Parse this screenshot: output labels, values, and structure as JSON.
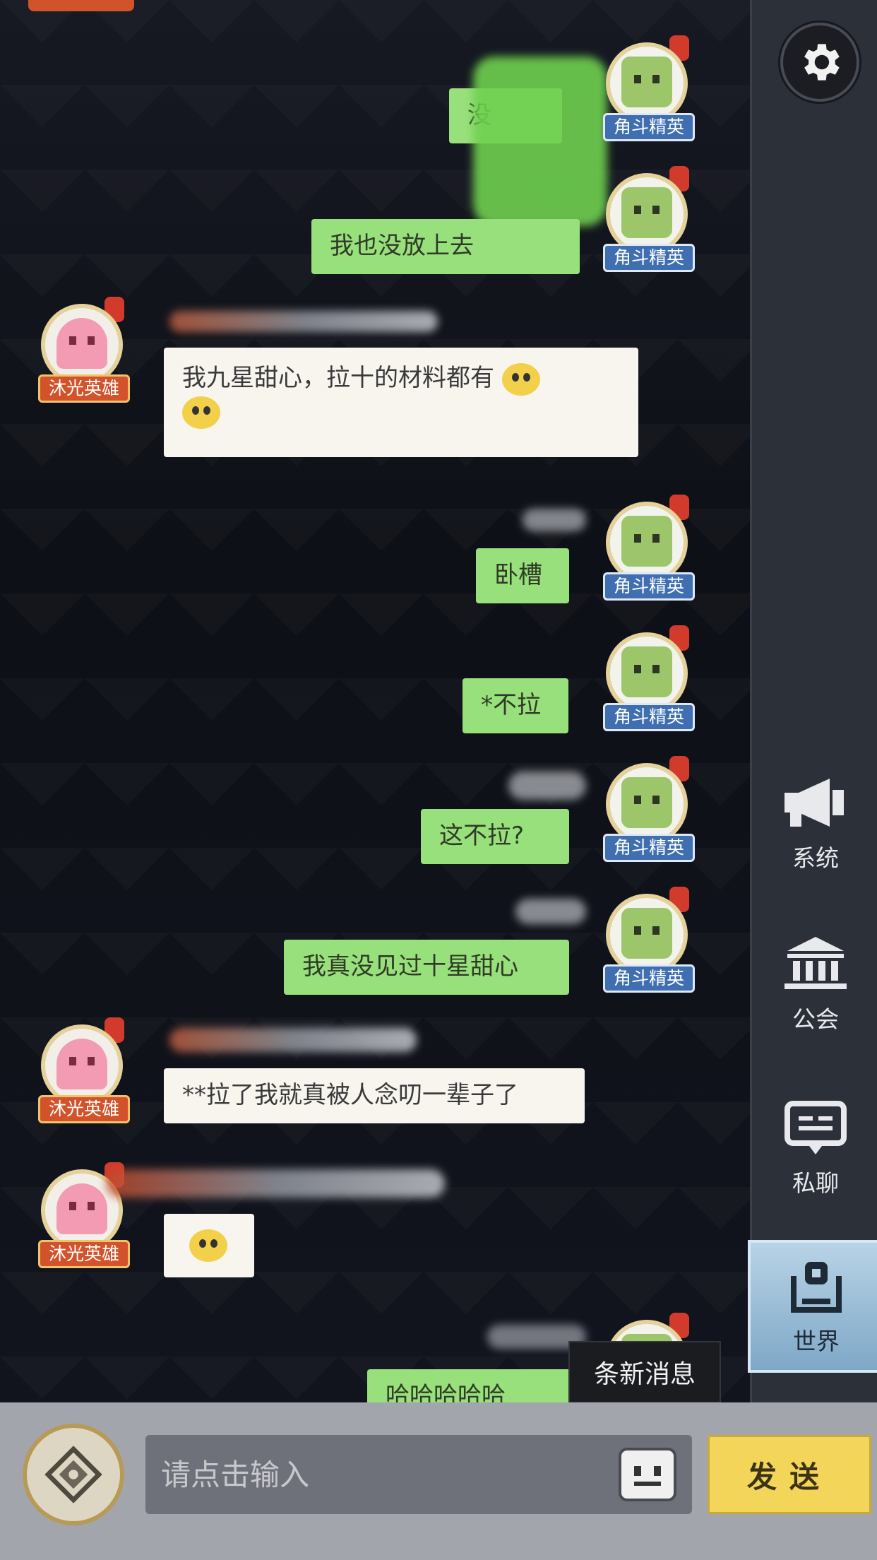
{
  "sidebar": {
    "settings_icon": "gear-icon",
    "tabs": [
      {
        "label": "系统",
        "icon": "megaphone-icon"
      },
      {
        "label": "公会",
        "icon": "guild-hall-icon"
      },
      {
        "label": "私聊",
        "icon": "chat-bubble-icon"
      },
      {
        "label": "世界",
        "icon": "world-icon"
      }
    ],
    "active_tab": "世界"
  },
  "badges": {
    "green": "角斗精英",
    "pink": "沐光英雄"
  },
  "messages": [
    {
      "side": "right",
      "badge": "角斗精英",
      "text": "没"
    },
    {
      "side": "right",
      "badge": "角斗精英",
      "text": "我也没放上去"
    },
    {
      "side": "left",
      "badge": "沐光英雄",
      "text": "我九星甜心，拉十的材料都有"
    },
    {
      "side": "right",
      "badge": "角斗精英",
      "text": "卧槽"
    },
    {
      "side": "right",
      "badge": "角斗精英",
      "text": "*不拉"
    },
    {
      "side": "right",
      "badge": "角斗精英",
      "text": "这不拉?"
    },
    {
      "side": "right",
      "badge": "角斗精英",
      "text": "我真没见过十星甜心"
    },
    {
      "side": "left",
      "badge": "沐光英雄",
      "text": "**拉了我就真被人念叨一辈子了"
    },
    {
      "side": "left",
      "badge": "沐光英雄",
      "text": ""
    },
    {
      "side": "right",
      "badge": "角斗精英",
      "text": "哈哈哈哈哈"
    }
  ],
  "new_message_label": "条新消息",
  "input": {
    "placeholder": "请点击输入",
    "send_label": "发送"
  },
  "colors": {
    "green_bubble": "#98e07b",
    "white_bubble": "#f8f5ee",
    "send_button": "#f3d55a",
    "active_tab": "#9cc0dc"
  }
}
